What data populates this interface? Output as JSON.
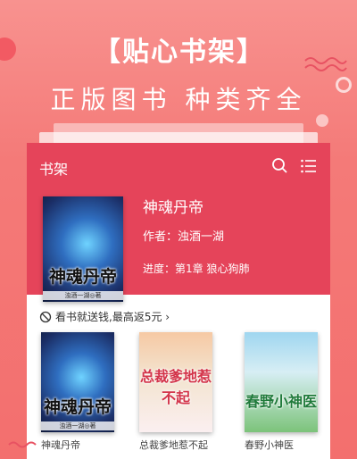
{
  "banner": {
    "title": "【贴心书架】",
    "subtitle": "正版图书 种类齐全"
  },
  "shelf": {
    "title": "书架",
    "current_book": {
      "name": "神魂丹帝",
      "author_label": "作者：浊酒一湖",
      "progress_label": "进度：第1章 狼心狗肺",
      "cover_title": "神魂丹帝",
      "cover_author": "浊酒一湖◎著"
    },
    "promo_text": "看书就送钱,最高返5元 ›",
    "books": [
      {
        "title": "神魂丹帝",
        "cover_title": "神魂丹帝",
        "cover_author": "浊酒一湖◎著"
      },
      {
        "title": "总裁爹地惹不起",
        "cover_title": "总裁爹地惹不起"
      },
      {
        "title": "春野小神医",
        "cover_title": "春野小神医"
      }
    ]
  },
  "colors": {
    "header": "#e5445a",
    "background": "#f47a78"
  }
}
